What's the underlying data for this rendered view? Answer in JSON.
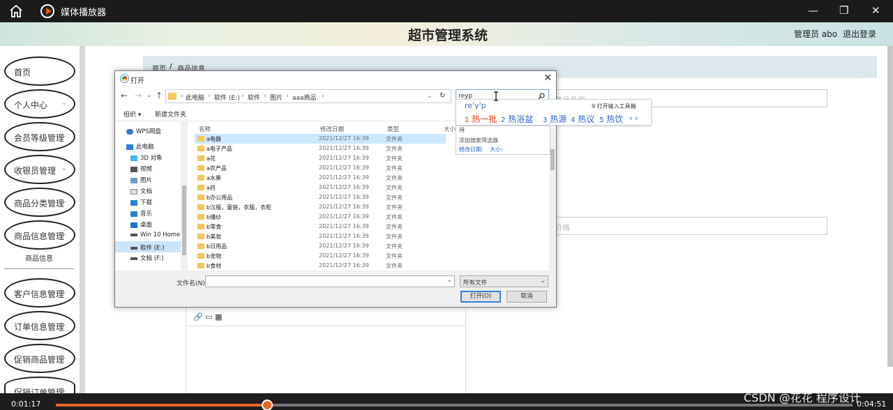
{
  "window": {
    "title": "媒体播放器",
    "minimize": "—",
    "restore": "❐",
    "close": "✕"
  },
  "header": {
    "system_title": "超市管理系统",
    "admin": "管理员 abo",
    "logout": "退出登录"
  },
  "sidebar": {
    "items": [
      {
        "label": "首页"
      },
      {
        "label": "个人中心"
      },
      {
        "label": "会员等级管理"
      },
      {
        "label": "收银员管理"
      },
      {
        "label": "商品分类管理"
      },
      {
        "label": "商品信息管理"
      },
      {
        "label": "客户信息管理"
      },
      {
        "label": "订单信息管理"
      },
      {
        "label": "促销商品管理"
      },
      {
        "label": "促销订单管理"
      }
    ],
    "subitem": "商品信息",
    "chevron": "⌄"
  },
  "breadcrumb": {
    "home": "首页",
    "sep": "/",
    "current": "商品信息"
  },
  "form": {
    "name_placeholder": "商品名称",
    "price_placeholder": "价格"
  },
  "editor": {
    "toolbar": "🔗  ▭  ▦"
  },
  "dialog": {
    "title": "打开",
    "close": "✕",
    "nav": {
      "back": "←",
      "forward": "→",
      "down": "⌄",
      "up": "↑",
      "refresh": "↻"
    },
    "address": [
      "此电脑",
      "软件 (E:)",
      "软件",
      "图片",
      "aaa商品"
    ],
    "address_sep": "›",
    "search_value": "reyp",
    "toolbar": {
      "organize": "组织 ▾",
      "new_folder": "新建文件夹"
    },
    "nav_pane": [
      "WPS网盘",
      "此电脑",
      "3D 对象",
      "视频",
      "图片",
      "文档",
      "下载",
      "音乐",
      "桌面",
      "Win 10 Home ›",
      "软件 (E:)",
      "文档 (F:)"
    ],
    "columns": {
      "name": "名称",
      "date": "修改日期",
      "type": "类型",
      "size": "大小"
    },
    "files": [
      {
        "name": "a电器",
        "date": "2021/12/27 16:39",
        "type": "文件夹"
      },
      {
        "name": "a电子产品",
        "date": "2021/12/27 16:39",
        "type": "文件夹"
      },
      {
        "name": "a花",
        "date": "2021/12/27 16:39",
        "type": "文件夹"
      },
      {
        "name": "a农产品",
        "date": "2021/12/27 16:39",
        "type": "文件夹"
      },
      {
        "name": "a水果",
        "date": "2021/12/27 16:39",
        "type": "文件夹"
      },
      {
        "name": "a药",
        "date": "2021/12/27 16:39",
        "type": "文件夹"
      },
      {
        "name": "b办公用品",
        "date": "2021/12/27 16:39",
        "type": "文件夹"
      },
      {
        "name": "b汉服，童装，衣服，衣柜",
        "date": "2021/12/27 16:39",
        "type": "文件夹"
      },
      {
        "name": "b播纱",
        "date": "2021/12/27 16:39",
        "type": "文件夹"
      },
      {
        "name": "b零食",
        "date": "2021/12/27 16:39",
        "type": "文件夹"
      },
      {
        "name": "b美妆",
        "date": "2021/12/27 16:39",
        "type": "文件夹"
      },
      {
        "name": "b日用品",
        "date": "2021/12/27 16:39",
        "type": "文件夹"
      },
      {
        "name": "b宠物",
        "date": "2021/12/27 16:39",
        "type": "文件夹"
      },
      {
        "name": "b食材",
        "date": "2021/12/27 16:39",
        "type": "文件夹"
      }
    ],
    "filename_label": "文件名(N):",
    "filetype": "所有文件",
    "open_button": "打开(O)",
    "cancel_button": "取消"
  },
  "ime": {
    "composition": "re'y'p",
    "hint": "9 打开输入工具箱",
    "candidates": [
      {
        "n": "1",
        "w": "热一批"
      },
      {
        "n": "2",
        "w": "热浴盆"
      },
      {
        "n": "3",
        "w": "热源"
      },
      {
        "n": "4",
        "w": "热议"
      },
      {
        "n": "5",
        "w": "热饮"
      }
    ],
    "arrows": "‹ ›"
  },
  "search_panel": {
    "row1": "待",
    "row2": "添加搜索筛选器",
    "row3a": "修改日期:",
    "row3b": "大小:"
  },
  "player": {
    "elapsed": "0:01:17",
    "total": "0:04:51",
    "progress": 0.265
  },
  "watermark": "CSDN @花花 程序设计"
}
